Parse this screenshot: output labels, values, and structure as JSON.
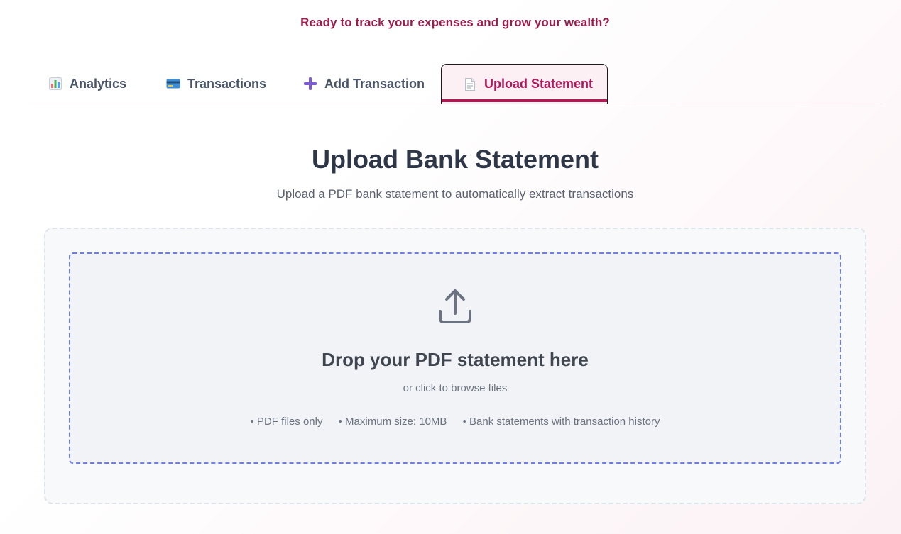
{
  "header": {
    "tagline": "Ready to track your expenses and grow your wealth?"
  },
  "tabs": [
    {
      "label": "Analytics",
      "icon": "bar-chart-icon",
      "active": false
    },
    {
      "label": "Transactions",
      "icon": "credit-card-icon",
      "active": false
    },
    {
      "label": "Add Transaction",
      "icon": "plus-icon",
      "active": false
    },
    {
      "label": "Upload Statement",
      "icon": "document-icon",
      "active": true
    }
  ],
  "main": {
    "title": "Upload Bank Statement",
    "subtitle": "Upload a PDF bank statement to automatically extract transactions"
  },
  "dropzone": {
    "icon": "upload-icon",
    "title": "Drop your PDF statement here",
    "subtitle": "or click to browse files",
    "requirements": [
      "• PDF files only",
      "• Maximum size: 10MB",
      "• Bank statements with transaction history"
    ]
  },
  "colors": {
    "accent": "#b01a55",
    "tagline": "#9b1c4a",
    "dropzone_border": "#6f7fe0",
    "plus_icon": "#7b5cd6"
  }
}
